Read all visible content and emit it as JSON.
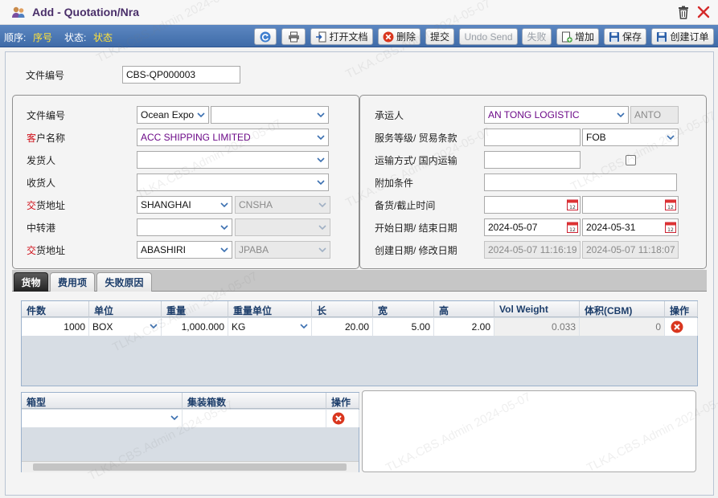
{
  "window": {
    "title": "Add - Quotation/Nra"
  },
  "toolbar": {
    "order_label": "顺序:",
    "order_value": "序号",
    "status_label": "状态:",
    "status_value": "状态",
    "buttons": {
      "open_doc": "打开文档",
      "delete": "删除",
      "submit": "提交",
      "undo_send": "Undo Send",
      "fail": "失败",
      "add": "增加",
      "save": "保存",
      "create_order": "创建订单"
    }
  },
  "doc": {
    "label": "文件编号",
    "value": "CBS-QP000003"
  },
  "left": {
    "doc_no_label": "文件编号",
    "doc_no_type": "Ocean Expo",
    "doc_no_value": "",
    "customer_label_mark": "客",
    "customer_label_rest": "户名称",
    "customer": "ACC SHIPPING LIMITED",
    "shipper_label": "发货人",
    "shipper": "",
    "consignee_label": "收货人",
    "consignee": "",
    "pol_label_mark": "交",
    "pol_label_rest": "货地址",
    "pol": "SHANGHAI",
    "pol_code": "CNSHA",
    "transit_label": "中转港",
    "transit": "",
    "transit_code": "",
    "pod_label_mark": "交",
    "pod_label_rest": "货地址",
    "pod": "ABASHIRI",
    "pod_code": "JPABA"
  },
  "right": {
    "carrier_label": "承运人",
    "carrier": "AN TONG LOGISTIC",
    "carrier_code": "ANTO",
    "service_label": "服务等级/ 贸易条款",
    "service": "",
    "incoterm": "FOB",
    "transport_label": "运输方式/ 国内运输",
    "transport": "",
    "extra_label": "附加条件",
    "extra": "",
    "cutoff_label": "备货/截止时间",
    "cutoff_from": "",
    "cutoff_to": "",
    "period_label": "开始日期/ 结束日期",
    "start_date": "2024-05-07",
    "end_date": "2024-05-31",
    "created_label": "创建日期/ 修改日期",
    "created": "2024-05-07 11:16:19",
    "modified": "2024-05-07 11:18:07"
  },
  "tabs": [
    "货物",
    "费用项",
    "失败原因"
  ],
  "cargo": {
    "headers": [
      "件数",
      "单位",
      "重量",
      "重量单位",
      "长",
      "宽",
      "高",
      "Vol Weight",
      "体积(CBM)",
      "操作"
    ],
    "row": {
      "pieces": "1000",
      "unit": "BOX",
      "weight": "1,000.000",
      "weight_unit": "KG",
      "length": "20.00",
      "width": "5.00",
      "height": "2.00",
      "vol_weight": "0.033",
      "cbm": "0"
    }
  },
  "container": {
    "headers": [
      "箱型",
      "集装箱数",
      "操作"
    ],
    "row": {
      "type": "",
      "count": ""
    }
  },
  "watermark": "TLKA.CBS.Admin 2024-05-07"
}
